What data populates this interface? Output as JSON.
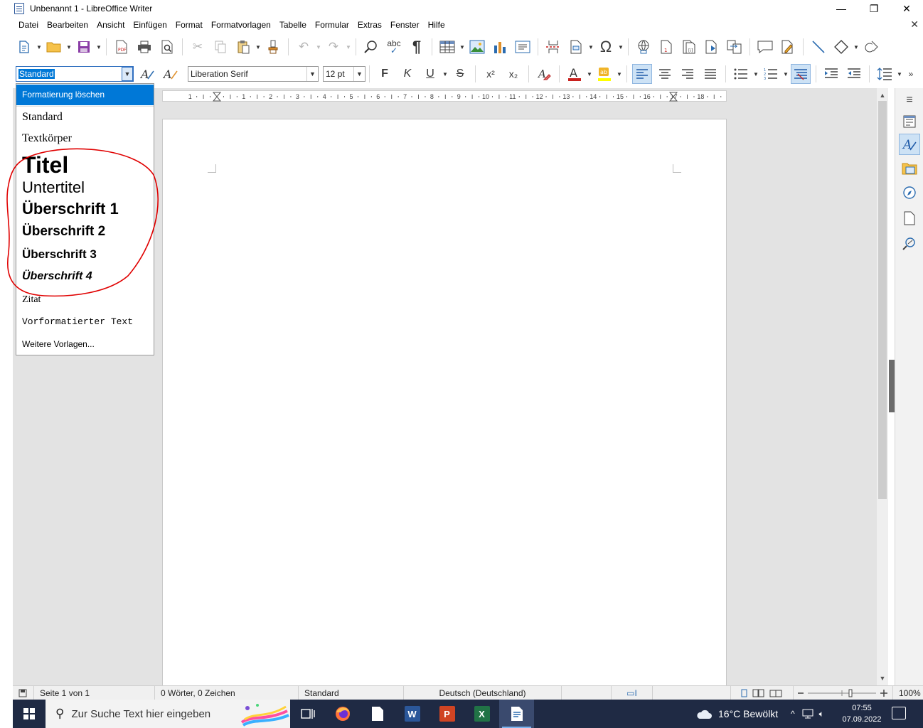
{
  "window": {
    "title": "Unbenannt 1 - LibreOffice Writer",
    "minimize": "—",
    "restore": "❐",
    "close": "✕"
  },
  "menu": {
    "items": [
      "Datei",
      "Bearbeiten",
      "Ansicht",
      "Einfügen",
      "Format",
      "Formatvorlagen",
      "Tabelle",
      "Formular",
      "Extras",
      "Fenster",
      "Hilfe"
    ],
    "close_document": "✕"
  },
  "formatting": {
    "paragraph_style": "Standard",
    "font_name": "Liberation Serif",
    "font_size": "12 pt",
    "bold": "F",
    "italic": "K",
    "underline": "U",
    "strikethrough": "S",
    "superscript": "x²",
    "subscript": "x₂",
    "font_color": "#c9211e",
    "highlight_color": "#ffff00"
  },
  "style_list": {
    "clear_formatting": "Formatierung löschen",
    "items": [
      "Standard",
      "Textkörper",
      "Titel",
      "Untertitel",
      "Überschrift 1",
      "Überschrift 2",
      "Überschrift 3",
      "Überschrift 4",
      "Zitat",
      "Vorformatierter Text"
    ],
    "more_styles": "Weitere Vorlagen...",
    "annotation_color": "#e00000"
  },
  "ruler": {
    "labels": [
      "1",
      "1",
      "2",
      "3",
      "4",
      "5",
      "6",
      "7",
      "8",
      "9",
      "10",
      "11",
      "12",
      "13",
      "14",
      "15",
      "16",
      "17",
      "18"
    ]
  },
  "status": {
    "page": "Seite 1 von 1",
    "words": "0 Wörter, 0 Zeichen",
    "page_style": "Standard",
    "language": "Deutsch (Deutschland)",
    "zoom": "100%"
  },
  "taskbar": {
    "search_placeholder": "Zur Suche Text hier eingeben",
    "apps": [
      "task-view",
      "firefox",
      "files",
      "word",
      "powerpoint",
      "excel",
      "libreoffice-writer"
    ],
    "weather": "16°C  Bewölkt",
    "time": "07:55",
    "date": "07.09.2022"
  },
  "colors": {
    "accent": "#0078d7",
    "taskbar": "#1f2a44",
    "workspace": "#e3e3e3"
  }
}
